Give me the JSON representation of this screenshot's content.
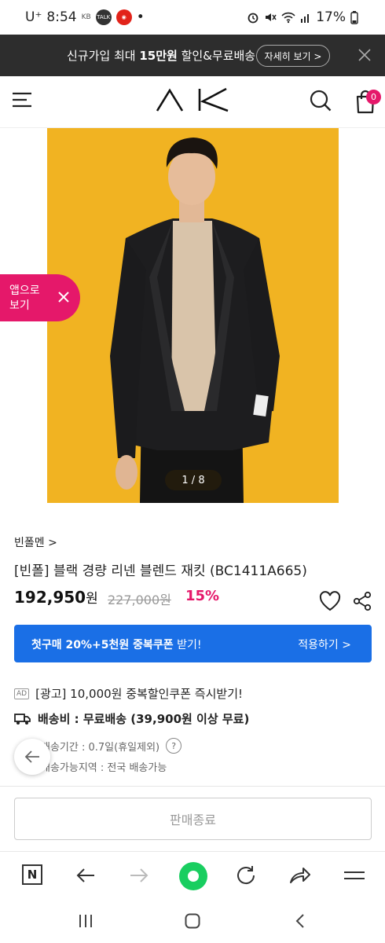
{
  "status_bar": {
    "carrier": "U⁺",
    "time": "8:54",
    "notif_1": "KB",
    "notif_2": "TALK",
    "more": "•",
    "battery": "17%"
  },
  "promo": {
    "text_prefix": "신규가입 최대 ",
    "text_bold": "15만원",
    "text_suffix": " 할인&무료배송",
    "button": "자세히 보기 >"
  },
  "header": {
    "logo": "AK",
    "cart_count": "0"
  },
  "app_badge": {
    "label": "앱으로 보기"
  },
  "gallery": {
    "counter": "1 / 8",
    "image_bg": "#f1b322"
  },
  "product": {
    "brand": "빈폴멘 >",
    "title": "[빈폴] 블랙 경량 리넨 블렌드 재킷 (BC1411A665)",
    "price": "192,950",
    "price_unit": "원",
    "original_price": "227,000원",
    "discount": "15%"
  },
  "coupon": {
    "text_bold": "첫구매 20%+5천원 중복쿠폰",
    "text_suffix": " 받기!",
    "action": "적용하기 >"
  },
  "ad": {
    "tag": "AD",
    "text": "[광고] 10,000원 중복할인쿠폰 즉시받기!"
  },
  "shipping": {
    "fee": "배송비 : 무료배송 (39,900원 이상 무료)",
    "period": "배송기간 : 0.7일(휴일제외)",
    "help": "?",
    "area": "배송가능지역 : 전국 배송가능"
  },
  "buy_button": {
    "label": "판매종료"
  },
  "browser": {
    "n_label": "N"
  },
  "colors": {
    "accent_pink": "#e5186a",
    "coupon_blue": "#1a6fe6",
    "promo_dark": "#2d2d2d",
    "naver_green": "#19ce60"
  }
}
